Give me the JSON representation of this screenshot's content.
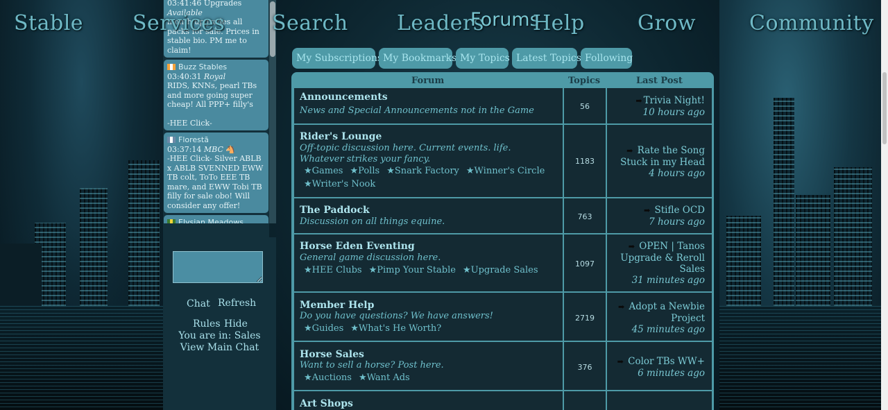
{
  "nav": {
    "stable": "Stable",
    "services": "Services",
    "search": "Search",
    "leaders": "Leaders",
    "help": "Help",
    "grow": "Grow",
    "community": "Community"
  },
  "page_title": "Forums",
  "chat": {
    "messages": [
      {
        "name": "",
        "time": "03:41:46 Upgrades",
        "role": "Available",
        "text": "month upgrades all packs for sale. Prices in stable bio. PM me to claim!"
      },
      {
        "name": "Buzz Stables",
        "time": "03:40:31",
        "role": "Royal",
        "text": "RIDS, KNNs, pearl TBs and more going super cheap! All PPP+ filly's",
        "extra": "-HEE Click-"
      },
      {
        "name": "Florestã",
        "time": "03:37:14",
        "role": "MBC",
        "text": "-HEE Click- Silver ABLB x ABLB SVENNED EWW TB colt, ToTo EEE TB mare, and EWW Tobi TB filly for sale obo! Will consider any offer!"
      },
      {
        "name": "Elysian Meadows",
        "time": "",
        "role": "",
        "text": ""
      }
    ],
    "chat_link": "Chat",
    "refresh_link": "Refresh",
    "rules_link": "Rules",
    "hide_link": "Hide",
    "location": "You are in: Sales",
    "view_main": "View Main Chat"
  },
  "tabs": [
    "My Subscriptions",
    "My Bookmarks",
    "My Topics",
    "Latest Topics",
    "Following"
  ],
  "table_headers": {
    "forum": "Forum",
    "topics": "Topics",
    "last_post": "Last Post"
  },
  "forums": [
    {
      "title": "Announcements",
      "desc": "News and Special Announcements not in the Game",
      "subs": [],
      "topics": "56",
      "last_title": "Trivia Night!",
      "last_ago": "10 hours ago"
    },
    {
      "title": "Rider's Lounge",
      "desc": "Off-topic discussion here. Current events. life. Whatever strikes your fancy.",
      "subs": [
        "★Games",
        "★Polls",
        "★Snark Factory",
        "★Winner's Circle",
        "★Writer's Nook"
      ],
      "topics": "1183",
      "last_title": "Rate the Song Stuck in my Head",
      "last_ago": "4 hours ago"
    },
    {
      "title": "The Paddock",
      "desc": "Discussion on all things equine.",
      "subs": [],
      "topics": "763",
      "last_title": "Stifle OCD",
      "last_ago": "7 hours ago"
    },
    {
      "title": "Horse Eden Eventing",
      "desc": "General game discussion here.",
      "subs": [
        "★HEE Clubs",
        "★Pimp Your Stable",
        "★Upgrade Sales"
      ],
      "topics": "1097",
      "last_title": "OPEN | Tanos Upgrade & Reroll Sales",
      "last_ago": "31 minutes ago"
    },
    {
      "title": "Member Help",
      "desc": "Do you have questions? We have answers!",
      "subs": [
        "★Guides",
        "★What's He Worth?"
      ],
      "topics": "2719",
      "last_title": "Adopt a Newbie Project",
      "last_ago": "45 minutes ago"
    },
    {
      "title": "Horse Sales",
      "desc": "Want to sell a horse? Post here.",
      "subs": [
        "★Auctions",
        "★Want Ads"
      ],
      "topics": "376",
      "last_title": "Color TBs WW+",
      "last_ago": "6 minutes ago"
    },
    {
      "title": "Art Shops",
      "desc": "",
      "subs": [],
      "topics": "",
      "last_title": "",
      "last_ago": ""
    }
  ],
  "icons": {
    "last_post": "right-arrow-icon",
    "flag": "flag-icon",
    "emoji": "horse-emoji-icon"
  },
  "colors": {
    "accent": "#4e9aa7",
    "cell_bg": "#142a33",
    "text_light": "#aee5ee",
    "text_mid": "#6fc0cc"
  }
}
